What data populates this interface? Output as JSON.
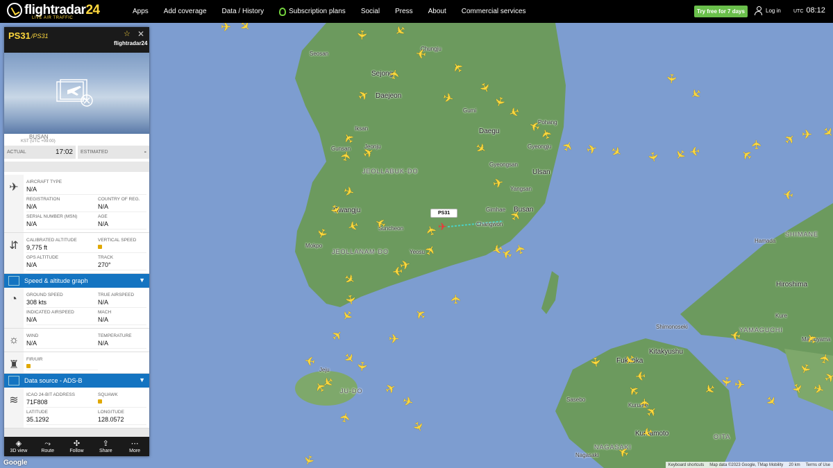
{
  "header": {
    "logo_text": "flightradar",
    "logo_num": "24",
    "logo_sub": "LIVE AIR TRAFFIC",
    "nav": [
      "Apps",
      "Add coverage",
      "Data / History",
      "Subscription plans",
      "Social",
      "Press",
      "About",
      "Commercial services"
    ],
    "try_label": "Try free for 7 days",
    "login_label": "Log in",
    "utc_label": "UTC",
    "utc_time": "08:12"
  },
  "panel": {
    "callsign": "PS31",
    "callsign_alt": "/PS31",
    "logo": "flightradar24",
    "airport_fragment": "BUSAN",
    "tz_label": "KST (UTC +09:00)",
    "actual_label": "ACTUAL",
    "actual_value": "17:02",
    "estimated_label": "ESTIMATED",
    "estimated_value": "-",
    "aircraft": {
      "type_label": "AIRCRAFT TYPE",
      "type_value": "N/A",
      "reg_label": "REGISTRATION",
      "reg_value": "N/A",
      "country_label": "COUNTRY OF REG.",
      "country_value": "N/A",
      "msn_label": "SERIAL NUMBER (MSN)",
      "msn_value": "N/A",
      "age_label": "AGE",
      "age_value": "N/A"
    },
    "altitude": {
      "cal_label": "CALIBRATED ALTITUDE",
      "cal_value": "9,775 ft",
      "vs_label": "VERTICAL SPEED",
      "gps_label": "GPS ALTITUDE",
      "gps_value": "N/A",
      "track_label": "TRACK",
      "track_value": "270°"
    },
    "speed_bar": "Speed & altitude graph",
    "speed": {
      "gs_label": "GROUND SPEED",
      "gs_value": "308 kts",
      "tas_label": "TRUE AIRSPEED",
      "tas_value": "N/A",
      "ias_label": "INDICATED AIRSPEED",
      "ias_value": "N/A",
      "mach_label": "MACH",
      "mach_value": "N/A"
    },
    "weather": {
      "wind_label": "WIND",
      "wind_value": "N/A",
      "temp_label": "TEMPERATURE",
      "temp_value": "N/A"
    },
    "fir_label": "FIR/UIR",
    "source_bar": "Data source - ADS-B",
    "source": {
      "icao_label": "ICAO 24-BIT ADDRESS",
      "icao_value": "71F808",
      "squawk_label": "SQUAWK",
      "lat_label": "LATITUDE",
      "lat_value": "35.1292",
      "lon_label": "LONGITUDE",
      "lon_value": "128.0572"
    },
    "toolbar": [
      "3D view",
      "Route",
      "Follow",
      "Share",
      "More"
    ]
  },
  "map": {
    "selected_callout": "PS31",
    "labels": [
      {
        "t": "Seosan",
        "c": "map-label"
      },
      {
        "t": "Sejong",
        "c": "map-label big"
      },
      {
        "t": "Daejeon",
        "c": "map-label big"
      },
      {
        "t": "Chungju",
        "c": "map-label"
      },
      {
        "t": "Gumi",
        "c": "map-label"
      },
      {
        "t": "Pohang",
        "c": "map-label"
      },
      {
        "t": "Gyeongju",
        "c": "map-label"
      },
      {
        "t": "Daegu",
        "c": "map-label big"
      },
      {
        "t": "Ulsan",
        "c": "map-label big"
      },
      {
        "t": "Busan",
        "c": "map-label big"
      },
      {
        "t": "Gimhae",
        "c": "map-label"
      },
      {
        "t": "Changwon",
        "c": "map-label"
      },
      {
        "t": "Iksan",
        "c": "map-label"
      },
      {
        "t": "Gunsan",
        "c": "map-label"
      },
      {
        "t": "Jeonju",
        "c": "map-label"
      },
      {
        "t": "JEOLLABUK-DO",
        "c": "map-label region"
      },
      {
        "t": "Gwangju",
        "c": "map-label big"
      },
      {
        "t": "Suncheon",
        "c": "map-label"
      },
      {
        "t": "JEOLLANAM-DO",
        "c": "map-label region"
      },
      {
        "t": "Mokpo",
        "c": "map-label"
      },
      {
        "t": "Yeosu",
        "c": "map-label"
      },
      {
        "t": "Jeju",
        "c": "map-label"
      },
      {
        "t": "JU-DO",
        "c": "map-label region"
      },
      {
        "t": "Hiroshima",
        "c": "map-label big"
      },
      {
        "t": "SHIMANE",
        "c": "map-label region"
      },
      {
        "t": "YAMAGUCHI",
        "c": "map-label region"
      },
      {
        "t": "Shimonoseki",
        "c": "map-label"
      },
      {
        "t": "Kitakyushu",
        "c": "map-label big"
      },
      {
        "t": "Fukuoka",
        "c": "map-label big"
      },
      {
        "t": "Kurume",
        "c": "map-label"
      },
      {
        "t": "Kumamoto",
        "c": "map-label big"
      },
      {
        "t": "Nagasaki",
        "c": "map-label"
      },
      {
        "t": "NAGASAKI",
        "c": "map-label region"
      },
      {
        "t": "OITA",
        "c": "map-label region"
      },
      {
        "t": "Sasebo",
        "c": "map-label"
      },
      {
        "t": "Matsuyama",
        "c": "map-label"
      },
      {
        "t": "Kure",
        "c": "map-label"
      },
      {
        "t": "Hamada",
        "c": "map-label"
      },
      {
        "t": "Yangsan",
        "c": "map-label"
      },
      {
        "t": "Gyeongsan",
        "c": "map-label"
      }
    ],
    "footer": [
      "Keyboard shortcuts",
      "Map data ©2023 Google, TMap Mobility",
      "20 km",
      "Terms of Use"
    ],
    "google": "Google"
  }
}
